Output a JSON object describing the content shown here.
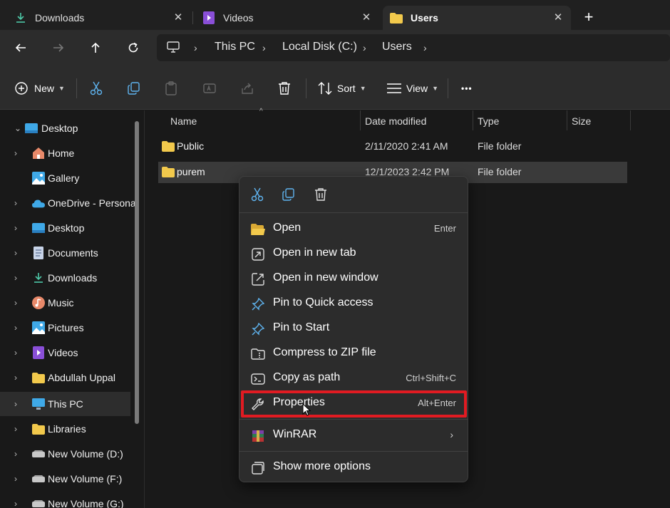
{
  "tabs": [
    {
      "label": "Downloads",
      "icon": "download-icon",
      "close": "✕"
    },
    {
      "label": "Videos",
      "icon": "videos-icon",
      "close": "✕"
    },
    {
      "label": "Users",
      "icon": "folder-icon",
      "close": "✕",
      "active": true
    }
  ],
  "new_tab_label": "+",
  "breadcrumb": {
    "items": [
      "This PC",
      "Local Disk (C:)",
      "Users"
    ],
    "separator": "›"
  },
  "toolbar": {
    "new_label": "New",
    "sort_label": "Sort",
    "view_label": "View",
    "more_label": "•••"
  },
  "sidebar": {
    "items": [
      {
        "label": "Desktop",
        "icon": "desktop-icon",
        "caret": "⌄"
      },
      {
        "label": "Home",
        "icon": "home-icon",
        "caret": "›"
      },
      {
        "label": "Gallery",
        "icon": "gallery-icon",
        "caret": ""
      },
      {
        "label": "OneDrive - Personal",
        "icon": "onedrive-icon",
        "caret": "›"
      },
      {
        "label": "Desktop",
        "icon": "desktop-icon",
        "caret": "›"
      },
      {
        "label": "Documents",
        "icon": "documents-icon",
        "caret": "›"
      },
      {
        "label": "Downloads",
        "icon": "download-icon",
        "caret": "›"
      },
      {
        "label": "Music",
        "icon": "music-icon",
        "caret": "›"
      },
      {
        "label": "Pictures",
        "icon": "pictures-icon",
        "caret": "›"
      },
      {
        "label": "Videos",
        "icon": "videos-icon",
        "caret": "›"
      },
      {
        "label": "Abdullah Uppal",
        "icon": "folder-icon",
        "caret": "›"
      },
      {
        "label": "This PC",
        "icon": "this-pc-icon",
        "caret": "›",
        "selected": true
      },
      {
        "label": "Libraries",
        "icon": "folder-icon",
        "caret": "›"
      },
      {
        "label": "New Volume (D:)",
        "icon": "drive-icon",
        "caret": "›"
      },
      {
        "label": "New Volume (F:)",
        "icon": "drive-icon",
        "caret": "›"
      },
      {
        "label": "New Volume (G:)",
        "icon": "drive-icon",
        "caret": "›"
      }
    ]
  },
  "columns": {
    "name": "Name",
    "date": "Date modified",
    "type": "Type",
    "size": "Size"
  },
  "files": [
    {
      "name": "Public",
      "date": "2/11/2020 2:41 AM",
      "type": "File folder"
    },
    {
      "name": "purem",
      "date": "12/1/2023 2:42 PM",
      "type": "File folder",
      "selected": true
    }
  ],
  "context_menu": {
    "items": [
      {
        "label": "Open",
        "shortcut": "Enter",
        "icon": "folder-open-icon"
      },
      {
        "label": "Open in new tab",
        "shortcut": "",
        "icon": "new-tab-icon"
      },
      {
        "label": "Open in new window",
        "shortcut": "",
        "icon": "new-window-icon"
      },
      {
        "label": "Pin to Quick access",
        "shortcut": "",
        "icon": "pin-icon"
      },
      {
        "label": "Pin to Start",
        "shortcut": "",
        "icon": "pin-icon"
      },
      {
        "label": "Compress to ZIP file",
        "shortcut": "",
        "icon": "zip-icon"
      },
      {
        "label": "Copy as path",
        "shortcut": "Ctrl+Shift+C",
        "icon": "copy-path-icon"
      },
      {
        "label": "Properties",
        "shortcut": "Alt+Enter",
        "icon": "wrench-icon",
        "highlighted": true
      },
      {
        "label": "WinRAR",
        "shortcut": "",
        "icon": "winrar-icon",
        "submenu": "›"
      },
      {
        "label": "Show more options",
        "shortcut": "",
        "icon": "more-options-icon"
      }
    ]
  },
  "colors": {
    "highlight_border": "#e11b22",
    "folder_yellow": "#f2c94c",
    "accent_blue": "#4aa8e8"
  }
}
